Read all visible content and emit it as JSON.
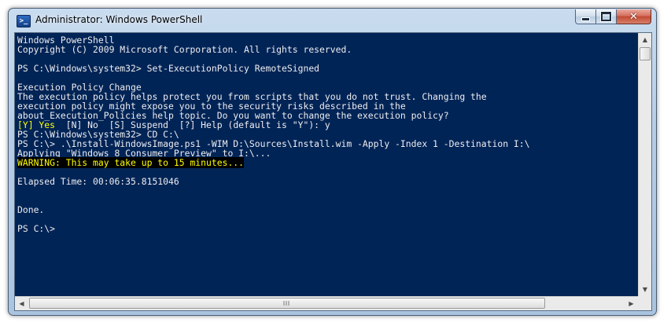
{
  "window": {
    "title": "Administrator: Windows PowerShell",
    "icon": "powershell-icon",
    "close_label": "✕"
  },
  "console": {
    "lines": [
      "Windows PowerShell",
      "Copyright (C) 2009 Microsoft Corporation. All rights reserved.",
      "",
      "PS C:\\Windows\\system32> Set-ExecutionPolicy RemoteSigned",
      "",
      "Execution Policy Change",
      "The execution policy helps protect you from scripts that you do not trust. Changing the",
      "execution policy might expose you to the security risks described in the",
      "about_Execution_Policies help topic. Do you want to change the execution policy?"
    ],
    "prompt_choice_yes": "[Y] Yes",
    "prompt_choice_rest": "  [N] No  [S] Suspend  [?] Help (default is \"Y\"): y",
    "lines_after": [
      "PS C:\\Windows\\system32> CD C:\\",
      "PS C:\\> .\\Install-WindowsImage.ps1 -WIM D:\\Sources\\Install.wim -Apply -Index 1 -Destination I:\\",
      "Applying \"Windows 8 Consumer Preview\" to I:\\..."
    ],
    "warning": "WARNING: This may take up to 15 minutes...",
    "lines_end": [
      "",
      "Elapsed Time: 00:06:35.8151046",
      "",
      "",
      "Done.",
      "",
      "PS C:\\>"
    ]
  },
  "colors": {
    "console_background": "#012456",
    "console_text": "#eeedf0",
    "warning_text": "#ffff00",
    "warning_background": "#000000"
  }
}
